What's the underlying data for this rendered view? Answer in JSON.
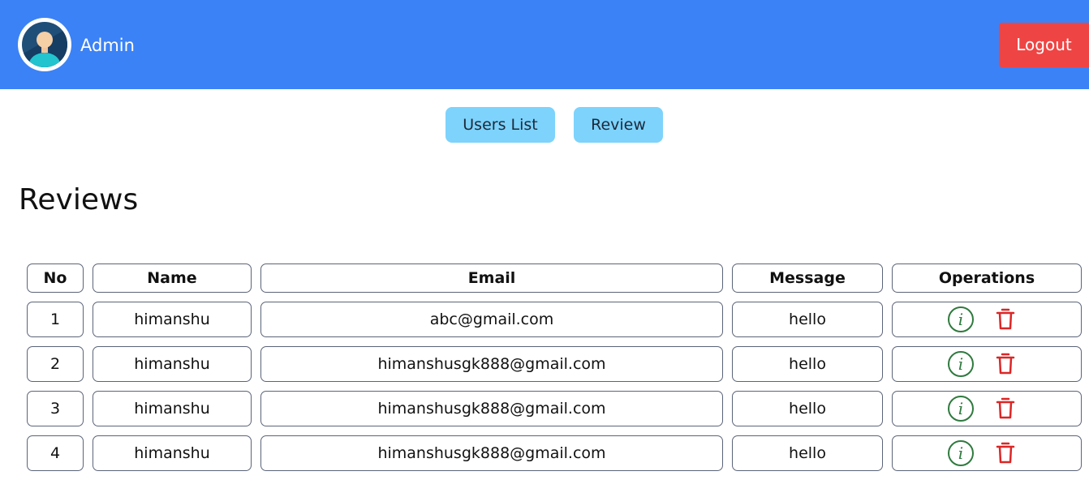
{
  "header": {
    "user_name": "Admin",
    "logout_label": "Logout",
    "colors": {
      "bar": "#3b82f6",
      "logout": "#ef4444"
    }
  },
  "nav": {
    "users_list_label": "Users List",
    "review_label": "Review"
  },
  "page": {
    "title": "Reviews"
  },
  "table": {
    "columns": [
      "No",
      "Name",
      "Email",
      "Message",
      "Operations"
    ],
    "rows": [
      {
        "no": "1",
        "name": "himanshu",
        "email": "abc@gmail.com",
        "message": "hello"
      },
      {
        "no": "2",
        "name": "himanshu",
        "email": "himanshusgk888@gmail.com",
        "message": "hello"
      },
      {
        "no": "3",
        "name": "himanshu",
        "email": "himanshusgk888@gmail.com",
        "message": "hello"
      },
      {
        "no": "4",
        "name": "himanshu",
        "email": "himanshusgk888@gmail.com",
        "message": "hello"
      }
    ],
    "operations_icons": [
      "info-icon",
      "trash-icon"
    ],
    "icon_colors": {
      "info": "#2f7a3e",
      "trash": "#dc2626"
    }
  }
}
